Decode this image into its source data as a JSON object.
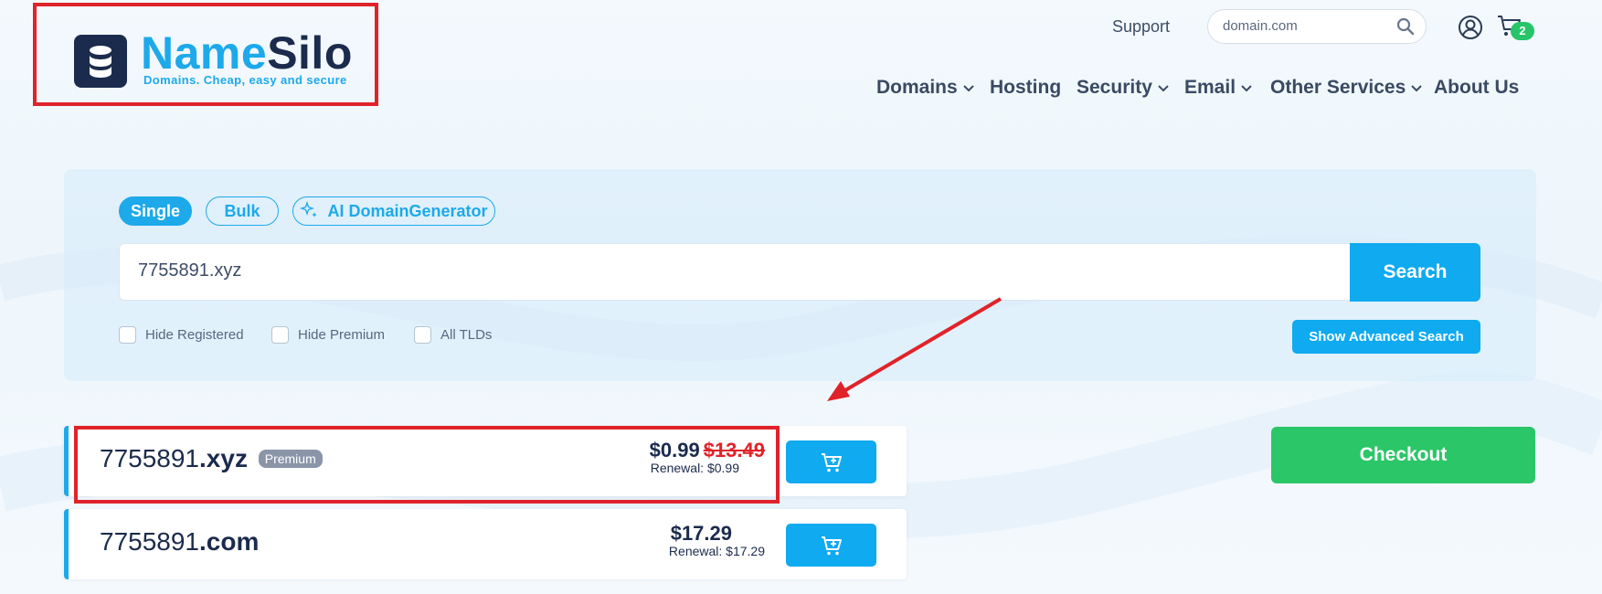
{
  "header": {
    "logo": {
      "name_part1": "Name",
      "name_part2": "Silo",
      "tagline": "Domains. Cheap, easy and secure"
    },
    "support_label": "Support",
    "search_placeholder": "domain.com",
    "cart_count": "2",
    "nav": [
      {
        "label": "Domains",
        "has_dropdown": true
      },
      {
        "label": "Hosting",
        "has_dropdown": false
      },
      {
        "label": "Security",
        "has_dropdown": true
      },
      {
        "label": "Email",
        "has_dropdown": true
      },
      {
        "label": "Other Services",
        "has_dropdown": true
      },
      {
        "label": "About Us",
        "has_dropdown": false
      }
    ]
  },
  "search": {
    "modes": [
      "Single",
      "Bulk",
      "AI DomainGenerator"
    ],
    "active_mode": "Single",
    "query_value": "7755891.xyz",
    "button_label": "Search",
    "options": [
      "Hide Registered",
      "Hide Premium",
      "All TLDs"
    ],
    "advanced_label": "Show Advanced Search"
  },
  "results": [
    {
      "name": "7755891",
      "tld": ".xyz",
      "badge": "Premium",
      "price": "$0.99",
      "old_price": "$13.49",
      "renewal": "Renewal: $0.99"
    },
    {
      "name": "7755891",
      "tld": ".com",
      "badge": "",
      "price": "$17.29",
      "old_price": "",
      "renewal": "Renewal: $17.29"
    }
  ],
  "checkout_label": "Checkout",
  "colors": {
    "accent": "#1da9ea",
    "button": "#0faaf0",
    "checkout": "#2bc667",
    "annotation": "#e0232a",
    "navy": "#1b2b4d"
  }
}
